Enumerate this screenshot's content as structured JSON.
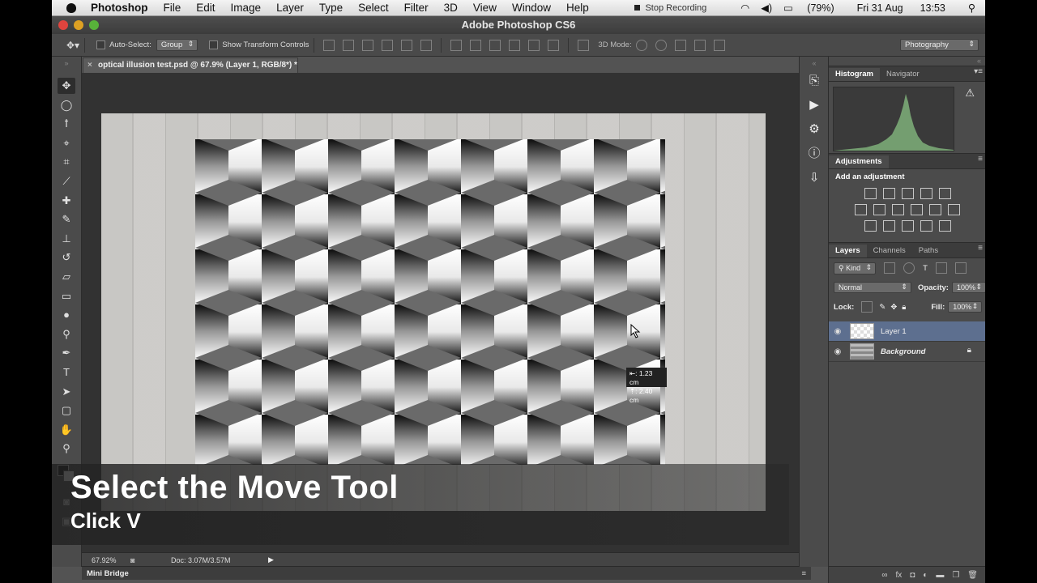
{
  "menubar": {
    "app": "Photoshop",
    "items": [
      "File",
      "Edit",
      "Image",
      "Layer",
      "Type",
      "Select",
      "Filter",
      "3D",
      "View",
      "Window",
      "Help"
    ],
    "stop_recording": "Stop Recording",
    "battery": "(79%)",
    "date": "Fri 31 Aug",
    "time": "13:53"
  },
  "window": {
    "title": "Adobe Photoshop CS6"
  },
  "options": {
    "auto_select_label": "Auto-Select:",
    "auto_select_value": "Group",
    "transform_label": "Show Transform Controls",
    "mode_3d_label": "3D Mode:",
    "workspace": "Photography"
  },
  "document": {
    "tab_title": "optical illusion test.psd @ 67.9% (Layer 1, RGB/8*) *",
    "tooltip_line1": "⇤: 1.23 cm",
    "tooltip_line2": "⇡: 2.40 cm"
  },
  "status": {
    "zoom": "67.92%",
    "doc": "Doc: 3.07M/3.57M"
  },
  "mini_bridge": "Mini Bridge",
  "caption": {
    "title": "Select the Move Tool",
    "subtitle": "Click V"
  },
  "panels": {
    "histogram_tab": "Histogram",
    "navigator_tab": "Navigator",
    "adjustments_tab": "Adjustments",
    "add_adjustment": "Add an adjustment",
    "layers_tab": "Layers",
    "channels_tab": "Channels",
    "paths_tab": "Paths",
    "kind_filter": "Kind",
    "blend_mode": "Normal",
    "opacity_label": "Opacity:",
    "opacity_value": "100%",
    "lock_label": "Lock:",
    "fill_label": "Fill:",
    "fill_value": "100%",
    "layers": [
      {
        "name": "Layer 1",
        "selected": true
      },
      {
        "name": "Background",
        "locked": true
      }
    ]
  },
  "colors": {
    "accent": "#5d6f8f",
    "histogram": "#7fb07a"
  }
}
